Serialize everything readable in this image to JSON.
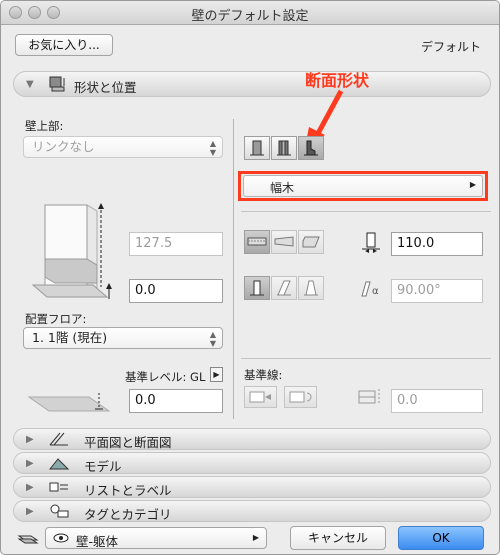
{
  "window": {
    "title": "壁のデフォルト設定"
  },
  "toolbar": {
    "favorites_label": "お気に入り...",
    "default_label": "デフォルト"
  },
  "section_geometry": {
    "label": "形状と位置"
  },
  "annotation": {
    "text": "断面形状",
    "color": "#ff3b1f"
  },
  "left": {
    "wall_top_label": "壁上部:",
    "wall_top_value": "リンクなし",
    "height_value": "127.5",
    "base_offset_value": "0.0",
    "home_floor_label": "配置フロア:",
    "home_floor_value": "1. 1階 (現在)",
    "ref_level_label": "基準レベル: GL",
    "ref_level_value": "0.0"
  },
  "right": {
    "profile_value": "幅木",
    "thickness_value": "110.0",
    "slant_value": "90.00°",
    "ref_line_label": "基準線:",
    "ref_offset_value": "0.0"
  },
  "sections": [
    {
      "label": "平面図と断面図"
    },
    {
      "label": "モデル"
    },
    {
      "label": "リストとラベル"
    },
    {
      "label": "タグとカテゴリ"
    }
  ],
  "footer": {
    "layer_value": "壁-躯体",
    "cancel_label": "キャンセル",
    "ok_label": "OK"
  },
  "colors": {
    "accent": "#ff3b1f",
    "ok_button": "#5aa3f5"
  }
}
